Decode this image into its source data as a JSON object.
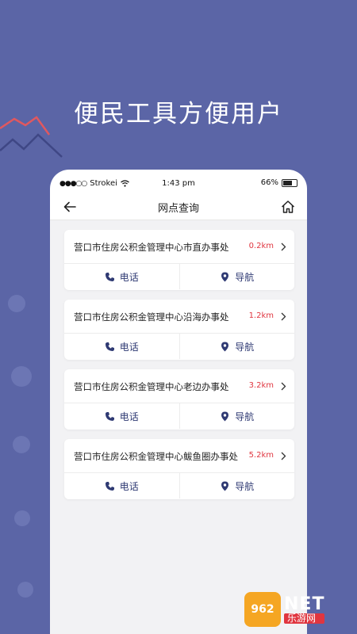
{
  "headline": "便民工具方便用户",
  "status": {
    "carrier": "Strokei",
    "time": "1:43 pm",
    "battery": "66%",
    "battery_level": 0.66
  },
  "nav": {
    "title": "网点查询"
  },
  "cards": [
    {
      "name": "营口市住房公积金管理中心市直办事处",
      "distance": "0.2km",
      "call_label": "电话",
      "nav_label": "导航"
    },
    {
      "name": "营口市住房公积金管理中心沿海办事处",
      "distance": "1.2km",
      "call_label": "电话",
      "nav_label": "导航"
    },
    {
      "name": "营口市住房公积金管理中心老边办事处",
      "distance": "3.2km",
      "call_label": "电话",
      "nav_label": "导航"
    },
    {
      "name": "营口市住房公积金管理中心鲅鱼圈办事处",
      "distance": "5.2km",
      "call_label": "电话",
      "nav_label": "导航"
    }
  ],
  "watermark": {
    "badge": "962",
    "net": "NET",
    "caption": "乐游网"
  },
  "colors": {
    "background": "#5b65a6",
    "distance": "#e0353f",
    "action": "#2f3a73"
  }
}
